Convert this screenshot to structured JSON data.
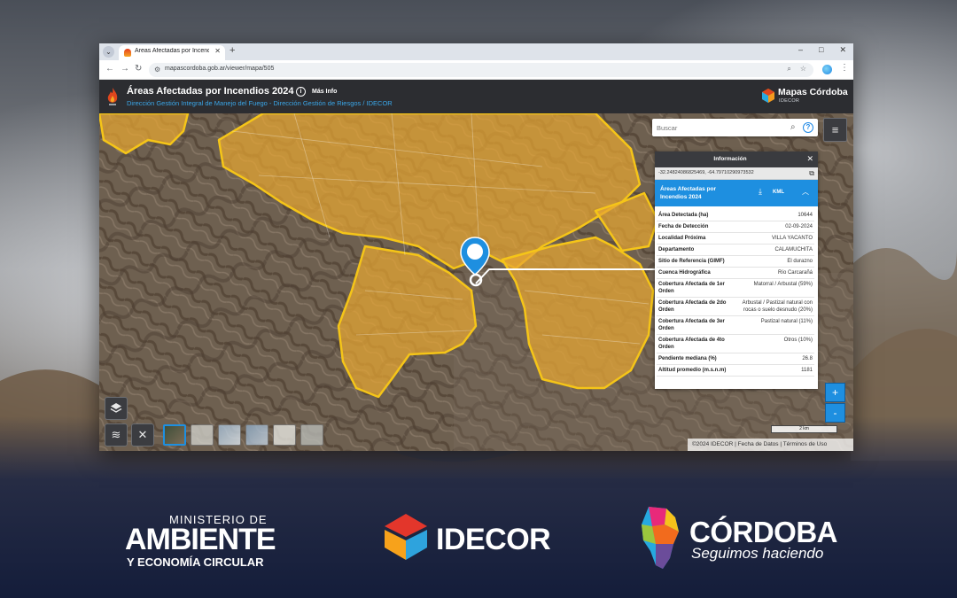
{
  "browser": {
    "tab_title": "Áreas Afectadas por Incendios",
    "tab_close": "✕",
    "new_tab": "+",
    "url": "mapascordoba.gob.ar/viewer/mapa/505"
  },
  "app": {
    "title": "Áreas Afectadas por Incendios 2024",
    "subtitle": "Dirección Gestión Integral de Manejo del Fuego - Dirección Gestión de Riesgos / IDECOR",
    "more_info": "Más Info",
    "brand_name": "Mapas Córdoba",
    "brand_sub": "IDECOR"
  },
  "search": {
    "placeholder": "Buscar"
  },
  "info_panel": {
    "title": "Información",
    "coords": "-32.24824086825469, -64.79710290973532",
    "layer_name": "Áreas Afectadas por Incendios 2024",
    "download_label": "KML",
    "attributes": [
      {
        "key": "Área Detectada (ha)",
        "value": "10644"
      },
      {
        "key": "Fecha de Detección",
        "value": "02-09-2024"
      },
      {
        "key": "Localidad Próxima",
        "value": "VILLA YACANTO"
      },
      {
        "key": "Departamento",
        "value": "CALAMUCHITA"
      },
      {
        "key": "Sitio de Referencia (GIMF)",
        "value": "El durazno"
      },
      {
        "key": "Cuenca Hidrográfica",
        "value": "Río Carcarañá"
      },
      {
        "key": "Cobertura Afectada de 1er Orden",
        "value": "Matorral / Arbustal (59%)"
      },
      {
        "key": "Cobertura Afectada de 2do Orden",
        "value": "Arbustal / Pastizal natural con rocas o suelo desnudo (20%)"
      },
      {
        "key": "Cobertura Afectada de 3er Orden",
        "value": "Pastizal natural (11%)"
      },
      {
        "key": "Cobertura Afectada de 4to Orden",
        "value": "Otros (10%)"
      },
      {
        "key": "Pendiente mediana (%)",
        "value": "26.8"
      },
      {
        "key": "Altitud promedio (m.s.n.m)",
        "value": "1181"
      }
    ]
  },
  "map_controls": {
    "zoom_in": "+",
    "zoom_out": "-",
    "scale_label": "2 km",
    "attribution": "©2024 IDECOR | Fecha de Datos | Términos de Uso"
  },
  "footer": {
    "ministerio_top": "MINISTERIO DE",
    "ministerio_main": "AMBIENTE",
    "ministerio_bottom": "Y ECONOMÍA CIRCULAR",
    "idecor": "IDECOR",
    "cordoba": "CÓRDOBA",
    "cordoba_slogan": "Seguimos haciendo"
  },
  "colors": {
    "accent_blue": "#1e8fe0",
    "burn_area": "#e8a632",
    "header_bg": "#2c2d31"
  }
}
